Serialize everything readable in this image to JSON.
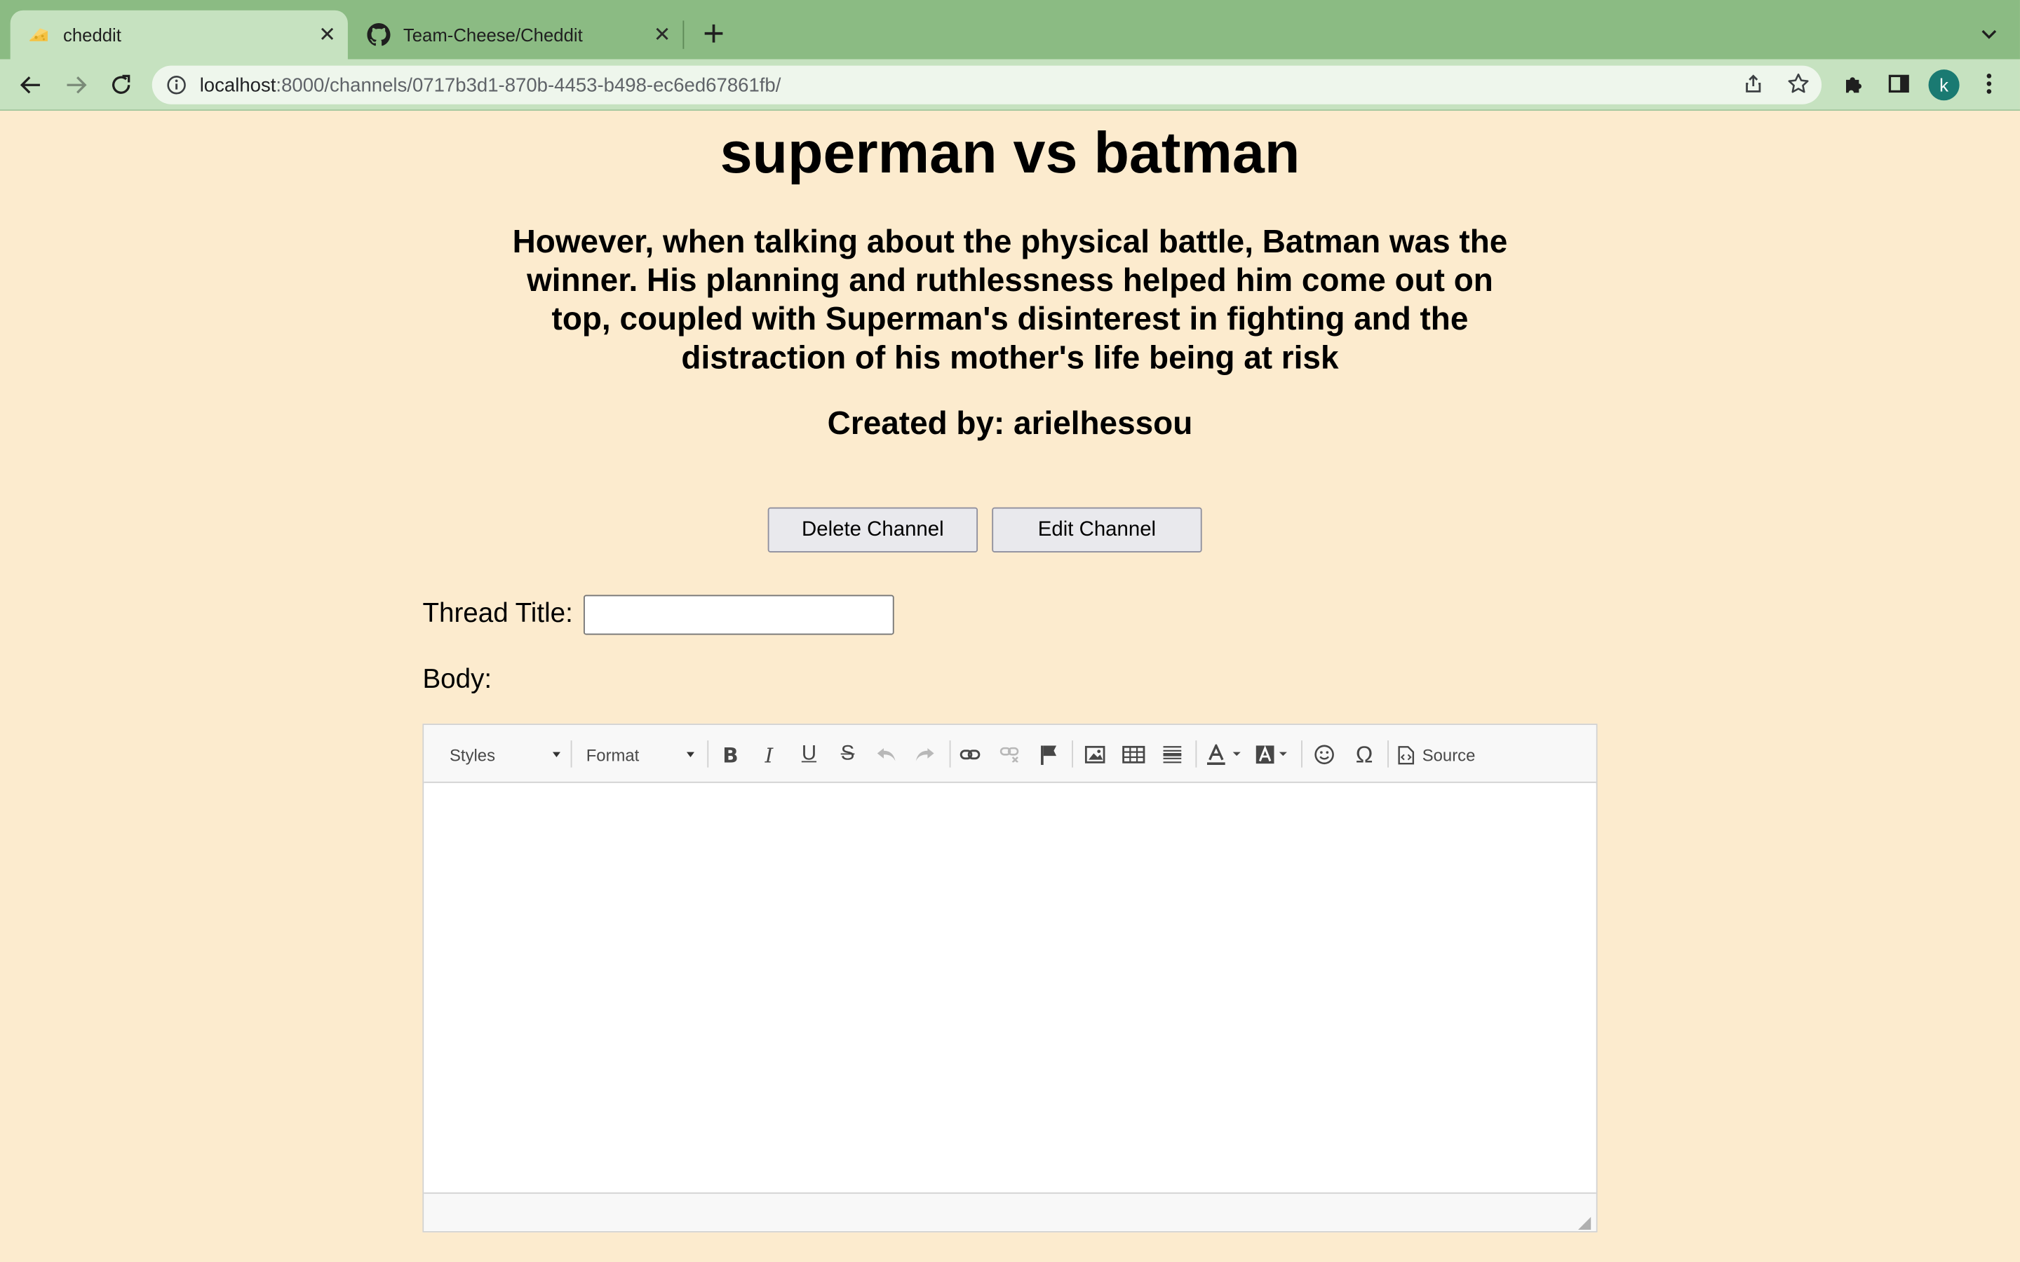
{
  "browser": {
    "tabs": [
      {
        "title": "cheddit",
        "active": true,
        "icon": "cheese-icon"
      },
      {
        "title": "Team-Cheese/Cheddit",
        "active": false,
        "icon": "github-icon"
      }
    ],
    "url_host": "localhost",
    "url_path": ":8000/channels/0717b3d1-870b-4453-b498-ec6ed67861fb/",
    "avatar_letter": "k",
    "accent_color": "#8bbb83",
    "toolbar_color": "#c6e2c0"
  },
  "channel": {
    "title": "superman vs batman",
    "description": "However, when talking about the physical battle, Batman was the winner. His planning and ruthlessness helped him come out on top, coupled with Superman's disinterest in fighting and the distraction of his mother's life being at risk",
    "creator_label": "Created by: arielhessou",
    "background_color": "#fcebce"
  },
  "actions": {
    "delete_label": "Delete Channel",
    "edit_label": "Edit Channel"
  },
  "form": {
    "thread_title_label": "Thread Title:",
    "thread_title_value": "",
    "body_label": "Body:"
  },
  "editor": {
    "styles_label": "Styles",
    "format_label": "Format",
    "source_label": "Source",
    "buttons": [
      "bold-icon",
      "italic-icon",
      "underline-icon",
      "strikethrough-icon",
      "undo-icon",
      "redo-icon",
      "link-icon",
      "unlink-icon",
      "anchor-icon",
      "image-icon",
      "table-icon",
      "horizontal-line-icon",
      "text-color-icon",
      "background-color-icon",
      "smiley-icon",
      "special-char-icon",
      "source-icon"
    ]
  }
}
